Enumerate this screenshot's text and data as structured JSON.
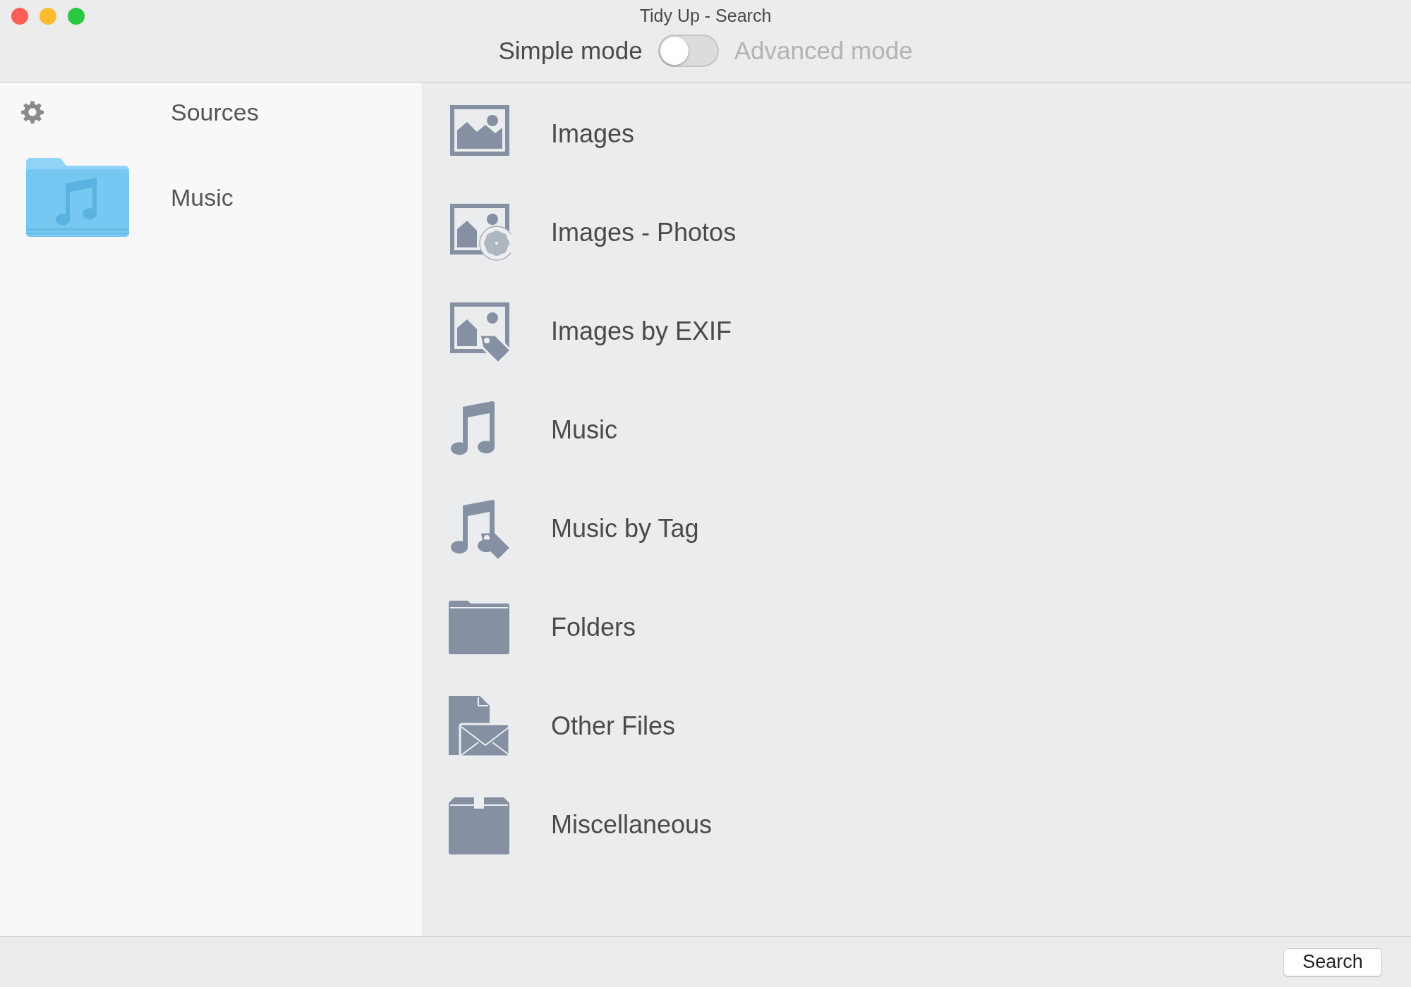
{
  "window": {
    "title": "Tidy Up - Search"
  },
  "mode_switch": {
    "left_label": "Simple mode",
    "right_label": "Advanced mode",
    "on": false
  },
  "sources": {
    "header": "Sources",
    "items": [
      {
        "label": "Music",
        "kind": "music-folder"
      }
    ]
  },
  "categories": [
    {
      "label": "Images",
      "kind": "image"
    },
    {
      "label": "Images - Photos",
      "kind": "photos"
    },
    {
      "label": "Images by EXIF",
      "kind": "exif"
    },
    {
      "label": "Music",
      "kind": "music"
    },
    {
      "label": "Music by Tag",
      "kind": "music-tag"
    },
    {
      "label": "Folders",
      "kind": "folder"
    },
    {
      "label": "Other Files",
      "kind": "files"
    },
    {
      "label": "Miscellaneous",
      "kind": "misc"
    }
  ],
  "buttons": [
    "Search"
  ]
}
